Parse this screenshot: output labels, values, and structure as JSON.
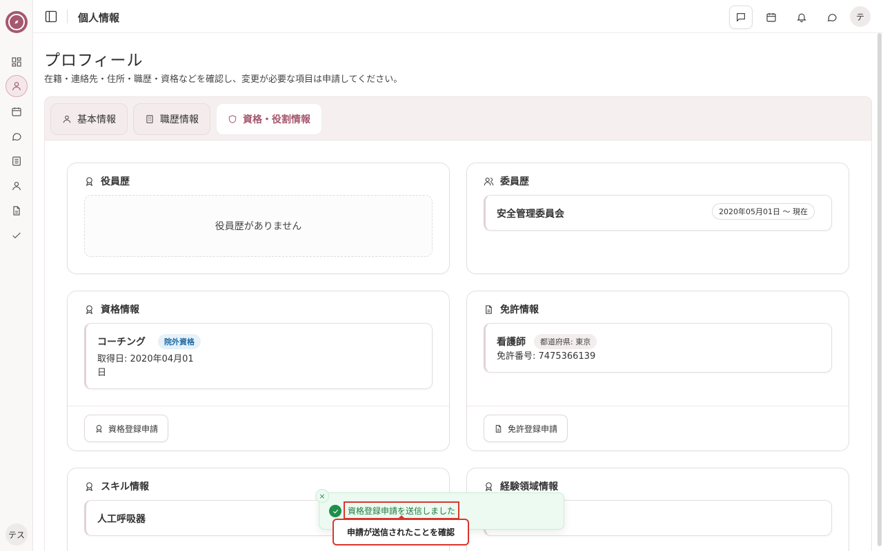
{
  "app": {
    "breadcrumb": "個人情報",
    "user_initial_rail": "テス",
    "user_initial_avatar": "テ"
  },
  "rail": {
    "items": [
      "dashboard-icon",
      "profile-icon",
      "calendar-icon",
      "chat-icon",
      "document-icon",
      "person-icon",
      "file-icon",
      "check-icon"
    ],
    "active": "profile-icon"
  },
  "topbar": {
    "icons": [
      "message-square-icon",
      "calendar-icon",
      "bell-icon",
      "chat-bubble-icon"
    ]
  },
  "page": {
    "title": "プロフィール",
    "description": "在籍・連絡先・住所・職歴・資格などを確認し、変更が必要な項目は申請してください。"
  },
  "tabs": [
    {
      "label": "基本情報",
      "icon": "user-icon"
    },
    {
      "label": "職歴情報",
      "icon": "building-icon"
    },
    {
      "label": "資格・役割情報",
      "icon": "shield-icon",
      "active": true
    }
  ],
  "colors": {
    "accent": "#a5586f",
    "success": "#1f8f4a",
    "highlight": "#d9352b"
  },
  "cards": {
    "officer": {
      "title": "役員歴",
      "empty_text": "役員歴がありません"
    },
    "committee": {
      "title": "委員歴",
      "items": [
        {
          "name": "安全管理委員会",
          "period": "2020年05月01日 〜 現在"
        }
      ]
    },
    "qualification": {
      "title": "資格情報",
      "items": [
        {
          "name": "コーチング",
          "badge": "院外資格",
          "acquired_line1": "取得日: 2020年04月01",
          "acquired_line2": "日"
        }
      ],
      "action": "資格登録申請"
    },
    "license": {
      "title": "免許情報",
      "items": [
        {
          "name": "看護師",
          "badge": "都道府県: 東京",
          "number": "免許番号: 7475366139"
        }
      ],
      "action": "免許登録申請"
    },
    "skill": {
      "title": "スキル情報",
      "items": [
        {
          "name": "人工呼吸器"
        }
      ]
    },
    "experience": {
      "title": "経験領域情報"
    }
  },
  "toast": {
    "message": "資格登録申請を送信しました",
    "close": "×"
  },
  "callout": {
    "text": "申請が送信されたことを確認"
  }
}
